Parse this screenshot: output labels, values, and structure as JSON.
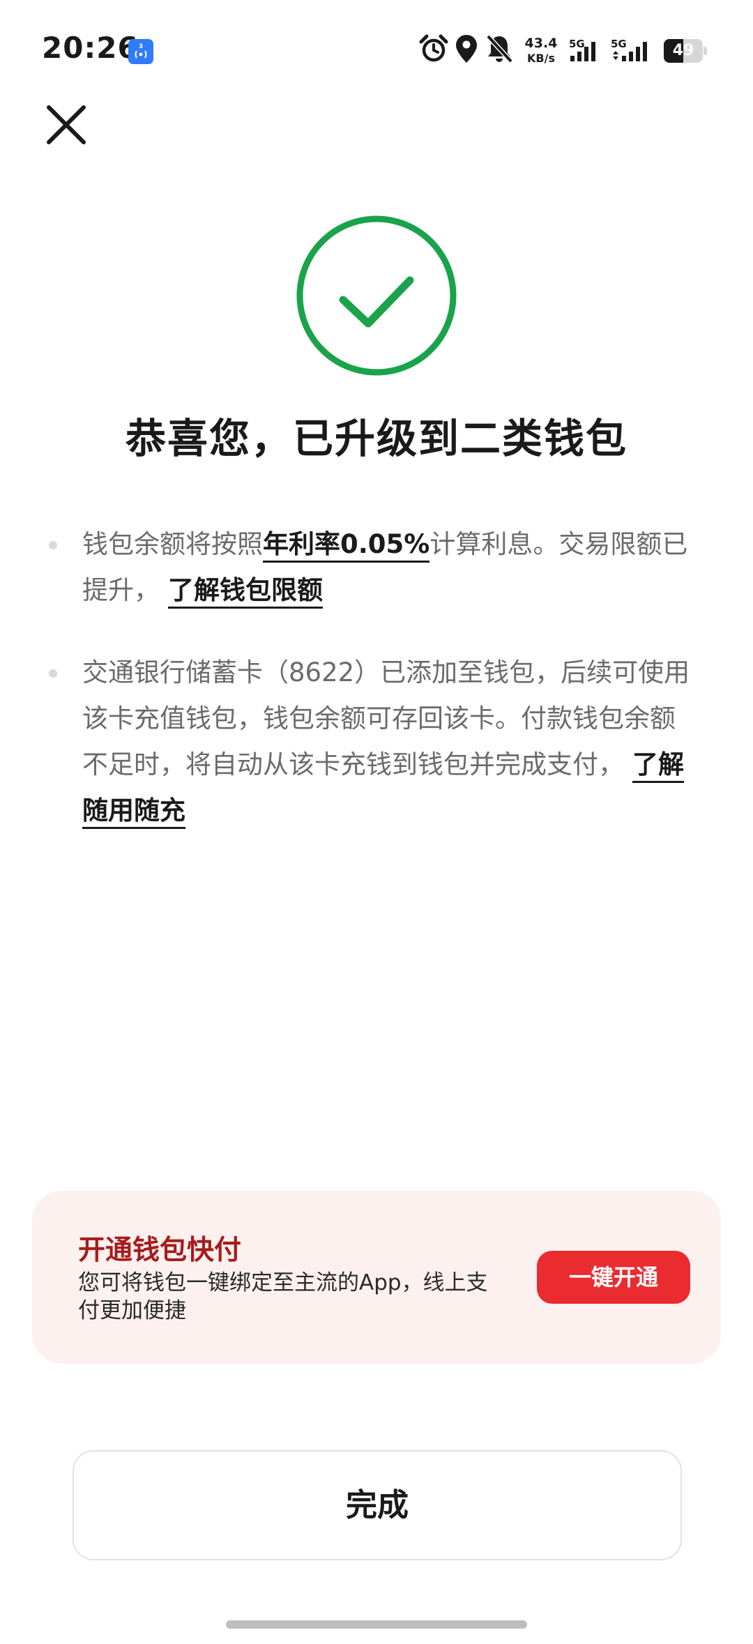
{
  "status_bar": {
    "time": "20:26",
    "nfc_badge_text": "3",
    "net_speed_value": "43.4",
    "net_speed_unit": "KB/s",
    "sim1_label": "5G",
    "sim2_label": "5G",
    "battery_level": "49",
    "icons": [
      "nfc-icon",
      "alarm-icon",
      "location-icon",
      "bell-off-icon",
      "signal-icon",
      "signal-icon",
      "battery-icon"
    ]
  },
  "header": {
    "close_icon": "close-icon"
  },
  "result": {
    "status_icon": "check-circle-icon",
    "status_color": "#1aa34a",
    "title": "恭喜您，已升级到二类钱包"
  },
  "info": {
    "item1": {
      "prefix": "钱包余额将按照",
      "rate": "年利率0.05%",
      "suffix": "计算利息。交易限额已提升，",
      "link": "了解钱包限额"
    },
    "item2": {
      "text": "交通银行储蓄卡（8622）已添加至钱包，后续可使用该卡充值钱包，钱包余额可存回该卡。付款钱包余额不足时，将自动从该卡充钱到钱包并完成支付，",
      "link": "了解随用随充"
    }
  },
  "promo": {
    "title": "开通钱包快付",
    "description": "您可将钱包一键绑定至主流的App，线上支付更加便捷",
    "button": "一键开通",
    "accent_color": "#ea2b30",
    "background_color": "#fdf1f0"
  },
  "footer": {
    "done_button": "完成"
  }
}
